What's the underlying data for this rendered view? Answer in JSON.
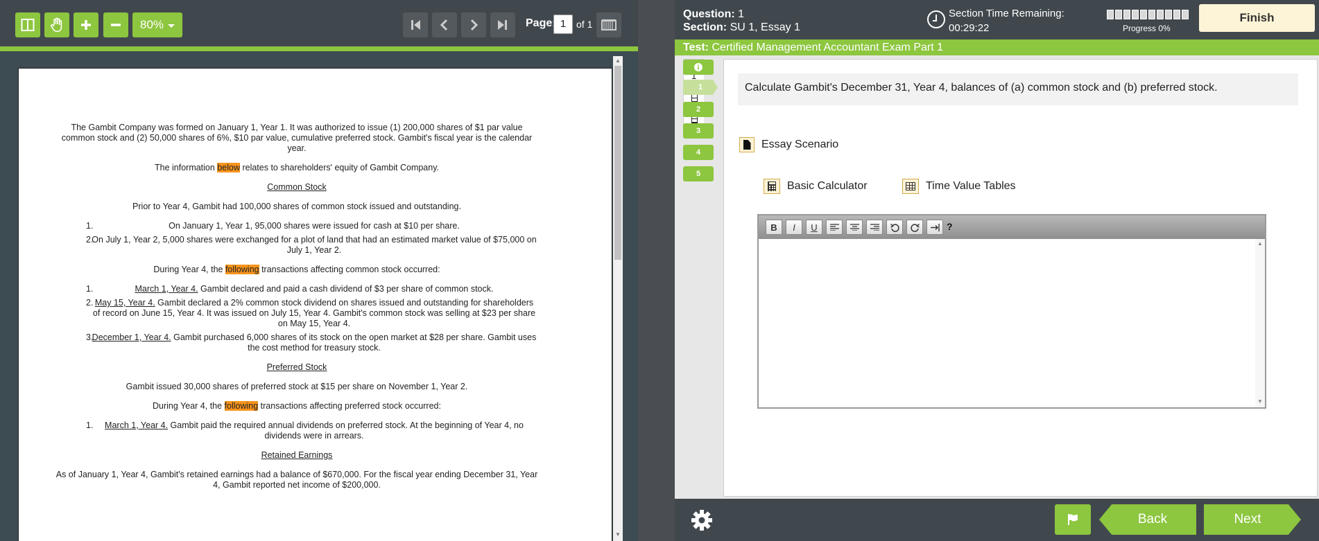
{
  "viewer": {
    "zoom": "80%",
    "page_label": "Page:",
    "page_value": "1",
    "page_of": "of 1",
    "document": {
      "p1": "The Gambit Company was formed on January 1, Year 1. It was authorized to issue (1) 200,000 shares of $1 par value common stock and (2) 50,000 shares of 6%, $10 par value, cumulative preferred stock. Gambit's fiscal year is the calendar year.",
      "p2_before": "The information ",
      "p2_highlight": "below",
      "p2_after": " relates to shareholders' equity of Gambit Company.",
      "h_common": "Common Stock",
      "p3": "Prior to Year 4, Gambit had 100,000 shares of common stock issued and outstanding.",
      "prior_items": [
        {
          "num": "1.",
          "text": "On January 1, Year 1, 95,000 shares were issued for cash at $10 per share."
        },
        {
          "num": "2.",
          "text": "On July 1, Year 2, 5,000 shares were exchanged for a plot of land that had an estimated market value of $75,000 on July 1, Year 2."
        }
      ],
      "p4_before": "During Year 4, the ",
      "p4_highlight": "following",
      "p4_after": " transactions affecting common stock occurred:",
      "common_items": [
        {
          "num": "1.",
          "date": "March 1, Year 4.",
          "text": " Gambit declared and paid a cash dividend of $3 per share of common stock."
        },
        {
          "num": "2.",
          "date": "May 15, Year 4.",
          "text": "  Gambit declared a 2% common stock dividend on shares issued and outstanding for shareholders of record on June 15, Year 4. It was issued on July 15, Year 4. Gambit's common stock was selling at $23 per share on May 15, Year 4."
        },
        {
          "num": "3.",
          "date": "December 1, Year 4.",
          "text": "  Gambit purchased 6,000 shares of its stock on the open market at $28 per share. Gambit uses the cost method for treasury stock."
        }
      ],
      "h_preferred": "Preferred Stock",
      "p5": "Gambit issued 30,000 shares of preferred stock at $15 per share on November 1, Year 2.",
      "p6_before": "During Year 4, the ",
      "p6_highlight": "following",
      "p6_after": " transactions affecting preferred stock occurred:",
      "pref_items": [
        {
          "num": "1.",
          "date": "March 1, Year 4.",
          "text": " Gambit paid the required annual dividends on preferred stock. At the beginning of Year 4, no dividends were in arrears."
        }
      ],
      "h_retained": "Retained Earnings",
      "p7": "As of January 1, Year 4, Gambit's retained earnings had a balance of $670,000. For the fiscal year ending December 31, Year 4, Gambit reported net income of $200,000."
    }
  },
  "exam": {
    "question_label": "Question:",
    "question_value": "1",
    "section_label": "Section:",
    "section_value": "SU 1, Essay 1",
    "time_label": "Section Time Remaining:",
    "time_value": "00:29:22",
    "progress_text": "Progress 0%",
    "progress_fraction": 0,
    "finish_label": "Finish",
    "test_label": "Test:",
    "test_value": "Certified Management Accountant Exam Part 1",
    "nav_tab_number": "1",
    "nav_info": "i",
    "nav_items": [
      "1",
      "2",
      "3",
      "4",
      "5"
    ],
    "question_text": "Calculate Gambit's December 31, Year 4, balances of (a) common stock and (b) preferred stock.",
    "scenario_label": "Essay Scenario",
    "calculator_label": "Basic Calculator",
    "tables_label": "Time Value Tables",
    "editor_help": "?",
    "back_label": "Back",
    "next_label": "Next"
  },
  "colors": {
    "accent_green": "#8dc63f",
    "header_dark": "#41484d",
    "highlight_orange": "#f7941d",
    "finish_bg": "#fdf3d6"
  },
  "icons": [
    "two-page-view-icon",
    "hand-pan-icon",
    "zoom-in-icon",
    "zoom-out-icon",
    "first-page-icon",
    "prev-page-icon",
    "next-page-icon",
    "last-page-icon",
    "book-icon",
    "clock-icon",
    "file-icon",
    "calculator-icon",
    "table-icon",
    "gear-icon",
    "flag-icon"
  ]
}
